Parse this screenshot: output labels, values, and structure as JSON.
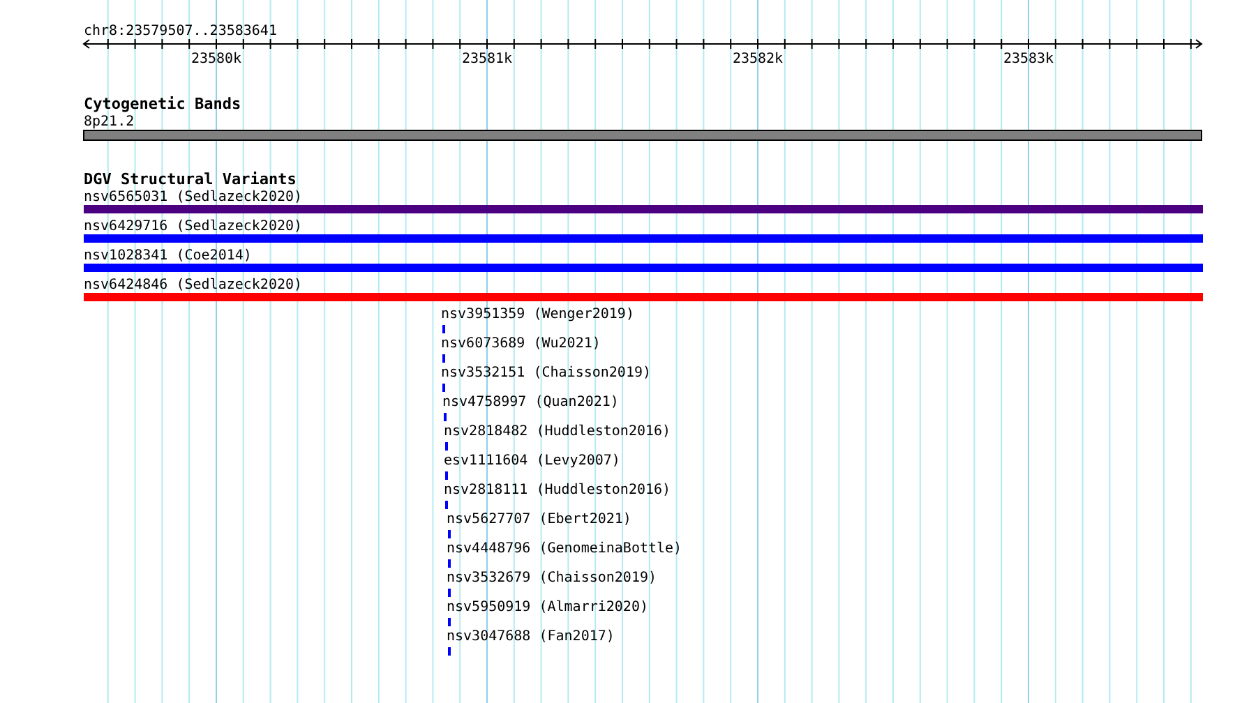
{
  "position": "chr8:23579507..23583641",
  "axis": {
    "labels": [
      "23580k",
      "23581k",
      "23582k",
      "23583k"
    ]
  },
  "cytogenetic_bands": {
    "title": "Cytogenetic Bands",
    "bands": [
      {
        "name": "8p21.2",
        "color": "#808080"
      }
    ]
  },
  "dgv_structural_variants": {
    "title": "DGV Structural Variants",
    "variants": [
      {
        "label": "nsv6565031 (Sedlazeck2020)",
        "kind": "spanning",
        "color": "#4b0082"
      },
      {
        "label": "nsv6429716 (Sedlazeck2020)",
        "kind": "spanning",
        "color": "#0000ff"
      },
      {
        "label": "nsv1028341 (Coe2014)",
        "kind": "spanning",
        "color": "#0000ff"
      },
      {
        "label": "nsv6424846 (Sedlazeck2020)",
        "kind": "spanning",
        "color": "#ff0000"
      },
      {
        "label": "nsv3951359 (Wenger2019)",
        "kind": "short",
        "color": "#0000ff"
      },
      {
        "label": "nsv6073689 (Wu2021)",
        "kind": "short",
        "color": "#0000ff"
      },
      {
        "label": "nsv3532151 (Chaisson2019)",
        "kind": "short",
        "color": "#0000ff"
      },
      {
        "label": "nsv4758997 (Quan2021)",
        "kind": "short",
        "color": "#0000ff"
      },
      {
        "label": "nsv2818482 (Huddleston2016)",
        "kind": "short",
        "color": "#0000ff"
      },
      {
        "label": "esv1111604 (Levy2007)",
        "kind": "short",
        "color": "#0000ff"
      },
      {
        "label": "nsv2818111 (Huddleston2016)",
        "kind": "short",
        "color": "#0000ff"
      },
      {
        "label": "nsv5627707 (Ebert2021)",
        "kind": "short",
        "color": "#0000ff"
      },
      {
        "label": "nsv4448796 (GenomeinaBottle)",
        "kind": "short",
        "color": "#0000ff"
      },
      {
        "label": "nsv3532679 (Chaisson2019)",
        "kind": "short",
        "color": "#0000ff"
      },
      {
        "label": "nsv5950919 (Almarri2020)",
        "kind": "short",
        "color": "#0000ff"
      },
      {
        "label": "nsv3047688 (Fan2017)",
        "kind": "short",
        "color": "#0000ff"
      }
    ]
  }
}
